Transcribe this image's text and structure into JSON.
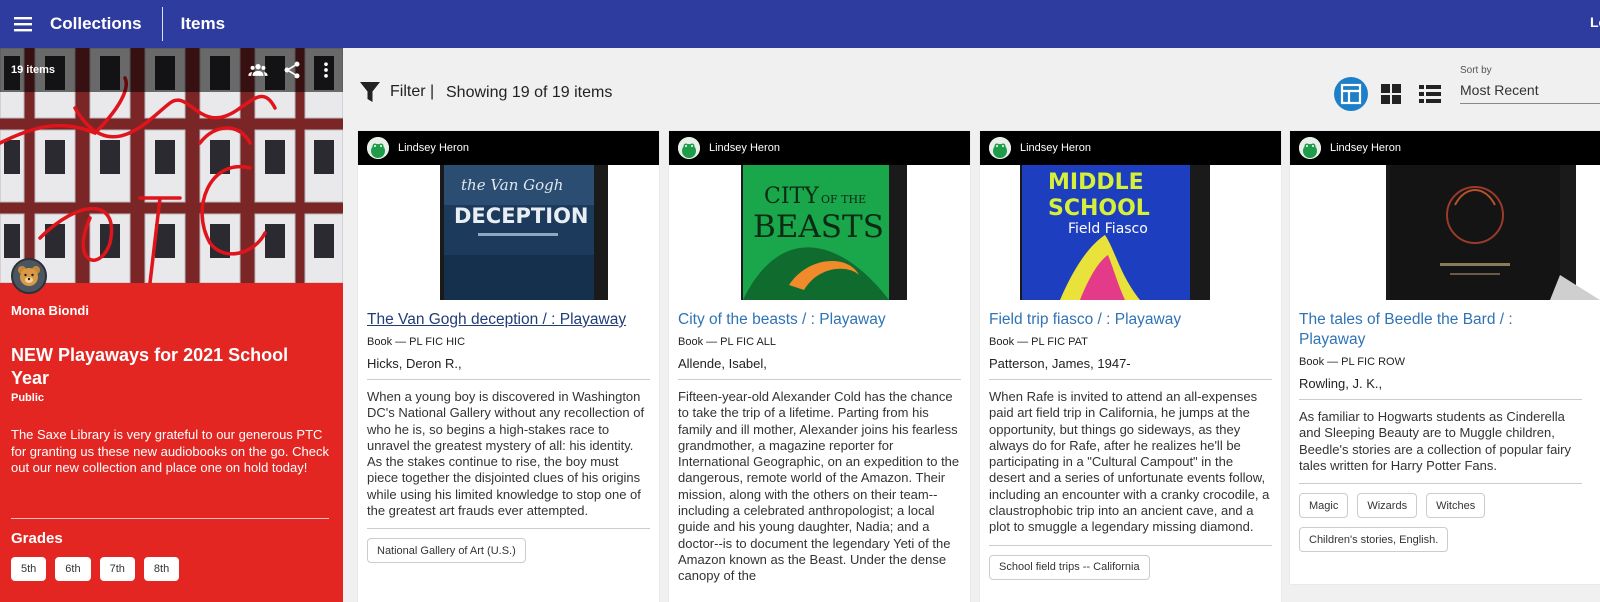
{
  "topbar": {
    "collections": "Collections",
    "items": "Items",
    "login": "Lo"
  },
  "sidebar": {
    "item_count": "19 items",
    "owner": "Mona Biondi",
    "title": "NEW Playaways for 2021 School Year",
    "visibility": "Public",
    "description": "The Saxe Library is very grateful to our generous PTC for granting us these new audiobooks on the go. Check out our new collection and place one on hold today!",
    "grades_label": "Grades",
    "grades": [
      "5th",
      "6th",
      "7th",
      "8th"
    ]
  },
  "toolbar": {
    "filter_label": "Filter |",
    "showing": "Showing 19 of 19 items",
    "sort_label": "Sort by",
    "sort_value": "Most Recent"
  },
  "cards": [
    {
      "user": "Lindsey Heron",
      "title": "The Van Gogh deception / : Playaway",
      "type": "Book — PL FIC HIC",
      "author": "Hicks, Deron R.,",
      "description": "When a young boy is discovered in Washington DC's National Gallery without any recollection of who he is, so begins a high-stakes race to unravel the greatest mystery of all: his identity. As the stakes continue to rise, the boy must piece together the disjointed clues of his origins while using his limited knowledge to stop one of the greatest art frauds ever attempted.",
      "tags": [
        "National Gallery of Art (U.S.)"
      ]
    },
    {
      "user": "Lindsey Heron",
      "title": "City of the beasts / : Playaway",
      "type": "Book — PL FIC ALL",
      "author": "Allende, Isabel,",
      "description": "Fifteen-year-old Alexander Cold has the chance to take the trip of a lifetime. Parting from his family and ill mother, Alexander joins his fearless grandmother, a magazine reporter for International Geographic, on an expedition to the dangerous, remote world of the Amazon. Their mission, along with the others on their team--including a celebrated anthropologist; a local guide and his young daughter, Nadia; and a doctor--is to document the legendary Yeti of the Amazon known as the Beast. Under the dense canopy of the",
      "tags": []
    },
    {
      "user": "Lindsey Heron",
      "title": "Field trip fiasco / : Playaway",
      "type": "Book — PL FIC PAT",
      "author": "Patterson, James, 1947-",
      "description": "When Rafe is invited to attend an all-expenses paid art field trip in California, he jumps at the opportunity, but things go sideways, as they always do for Rafe, after he realizes he'll be participating in a \"Cultural Campout\" in the desert and a series of unfortunate events follow, including an encounter with a cranky crocodile, a claustrophobic trip into an ancient cave, and a plot to smuggle a legendary missing diamond.",
      "tags": [
        "School field trips -- California"
      ]
    },
    {
      "user": "Lindsey Heron",
      "title": "The tales of Beedle the Bard / : Playaway",
      "type": "Book — PL FIC ROW",
      "author": "Rowling, J. K.,",
      "description": "As familiar to Hogwarts students as Cinderella and Sleeping Beauty are to Muggle children, Beedle's stories are a collection of popular fairy tales written for Harry Potter Fans.",
      "tags": [
        "Magic",
        "Wizards",
        "Witches",
        "Children's stories, English."
      ]
    }
  ],
  "colors": {
    "topbar": "#2f3c9f",
    "sidebar": "#e32622",
    "link": "#2f73b5",
    "active_view": "#1e7fc9"
  }
}
